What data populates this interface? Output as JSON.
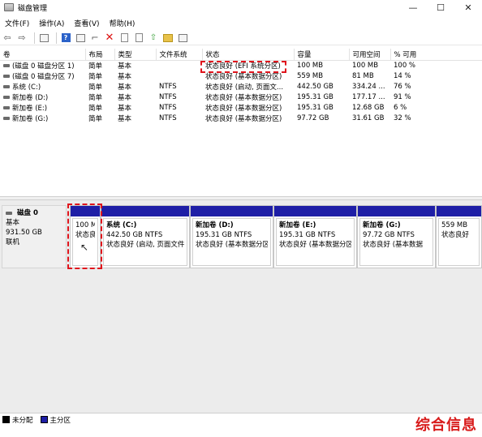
{
  "window": {
    "title": "磁盘管理",
    "controls": {
      "minimize": "—",
      "maximize": "☐",
      "close": "✕"
    }
  },
  "menu": [
    "文件(F)",
    "操作(A)",
    "查看(V)",
    "帮助(H)"
  ],
  "toolbar": {
    "icons": [
      "back-arrow-icon",
      "forward-arrow-icon",
      "console-tree-icon",
      "help-icon",
      "properties-icon",
      "delete-icon",
      "export-icon",
      "move-up-icon",
      "folder-icon",
      "view-icon"
    ]
  },
  "columns": [
    "卷",
    "布局",
    "类型",
    "文件系统",
    "状态",
    "容量",
    "可用空间",
    "% 可用"
  ],
  "volumes": [
    {
      "name": "(磁盘 0 磁盘分区 1)",
      "layout": "简单",
      "type": "基本",
      "fs": "",
      "status": "状态良好 (EFI 系统分区)",
      "capacity": "100 MB",
      "free": "100 MB",
      "pct": "100 %"
    },
    {
      "name": "(磁盘 0 磁盘分区 7)",
      "layout": "简单",
      "type": "基本",
      "fs": "",
      "status": "状态良好 (基本数据分区)",
      "capacity": "559 MB",
      "free": "81 MB",
      "pct": "14 %"
    },
    {
      "name": "系统 (C:)",
      "layout": "简单",
      "type": "基本",
      "fs": "NTFS",
      "status": "状态良好 (启动, 页面文...",
      "capacity": "442.50 GB",
      "free": "334.24 ...",
      "pct": "76 %"
    },
    {
      "name": "新加卷 (D:)",
      "layout": "简单",
      "type": "基本",
      "fs": "NTFS",
      "status": "状态良好 (基本数据分区)",
      "capacity": "195.31 GB",
      "free": "177.17 ...",
      "pct": "91 %"
    },
    {
      "name": "新加卷 (E:)",
      "layout": "简单",
      "type": "基本",
      "fs": "NTFS",
      "status": "状态良好 (基本数据分区)",
      "capacity": "195.31 GB",
      "free": "12.68 GB",
      "pct": "6 %"
    },
    {
      "name": "新加卷 (G:)",
      "layout": "简单",
      "type": "基本",
      "fs": "NTFS",
      "status": "状态良好 (基本数据分区)",
      "capacity": "97.72 GB",
      "free": "31.61 GB",
      "pct": "32 %"
    }
  ],
  "disk": {
    "name": "磁盘 0",
    "type": "基本",
    "size": "931.50 GB",
    "state": "联机"
  },
  "partitions": [
    {
      "label": "",
      "line1": "100 M",
      "line2": "状态良"
    },
    {
      "label": "系统  (C:)",
      "line1": "442.50 GB NTFS",
      "line2": "状态良好 (启动, 页面文件"
    },
    {
      "label": "新加卷  (D:)",
      "line1": "195.31 GB NTFS",
      "line2": "状态良好 (基本数据分区"
    },
    {
      "label": "新加卷  (E:)",
      "line1": "195.31 GB NTFS",
      "line2": "状态良好 (基本数据分区"
    },
    {
      "label": "新加卷  (G:)",
      "line1": "97.72 GB NTFS",
      "line2": "状态良好 (基本数据"
    },
    {
      "label": "",
      "line1": "559 MB",
      "line2": "状态良好"
    }
  ],
  "legend": [
    {
      "label": "未分配",
      "color": "#000000"
    },
    {
      "label": "主分区",
      "color": "#1e1ea6"
    }
  ],
  "watermark": "综合信息",
  "colors": {
    "primary_partition": "#1e1ea6",
    "highlight": "#e0141c"
  }
}
